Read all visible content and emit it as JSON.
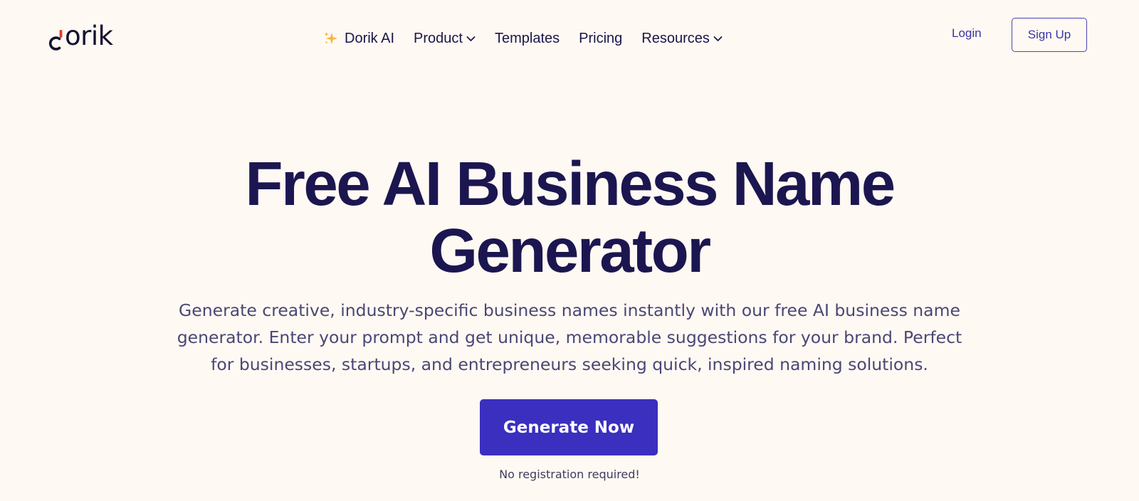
{
  "brand": {
    "logo_text": "orik"
  },
  "nav": {
    "items": [
      {
        "label": "Dorik AI",
        "icon": "sparkle-icon"
      },
      {
        "label": "Product",
        "icon": "chevron-down-icon"
      },
      {
        "label": "Templates"
      },
      {
        "label": "Pricing"
      },
      {
        "label": "Resources",
        "icon": "chevron-down-icon"
      }
    ]
  },
  "auth": {
    "login_label": "Login",
    "signup_label": "Sign Up"
  },
  "hero": {
    "title_line1": "Free AI Business Name",
    "title_line2": "Generator",
    "description": "Generate creative, industry-specific business names instantly with our free AI business name generator. Enter your prompt and get unique, memorable suggestions for your brand. Perfect for businesses, startups, and entrepreneurs seeking quick, inspired naming solutions.",
    "cta_label": "Generate Now",
    "cta_note": "No registration required!"
  },
  "colors": {
    "background": "#fef9f3",
    "heading": "#1c1650",
    "accent": "#3b2fbf",
    "link": "#3a35a5",
    "sparkle": "#f4b73f"
  }
}
